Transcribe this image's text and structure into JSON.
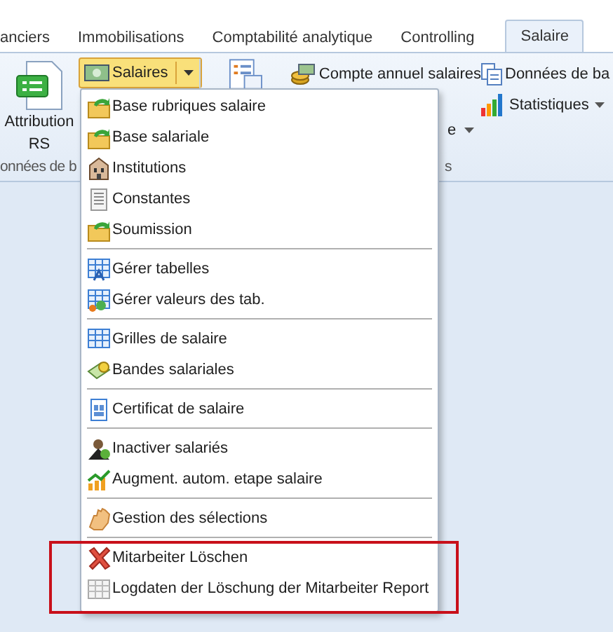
{
  "tabs": [
    {
      "label": "anciers",
      "selected": false
    },
    {
      "label": "Immobilisations",
      "selected": false
    },
    {
      "label": "Comptabilité analytique",
      "selected": false
    },
    {
      "label": "Controlling",
      "selected": false
    },
    {
      "label": "Salaire",
      "selected": true
    }
  ],
  "ribbon": {
    "attribution": {
      "lines": [
        "Attribution",
        "RS"
      ]
    },
    "salaires_button": {
      "label": "Salaires",
      "pressed": true
    },
    "compte_annuel": "Compte annuel salaires",
    "partial_dropdown": "e",
    "donnees": "Données de ba",
    "statistiques": "Statistiques",
    "group_labels": [
      "onnées de b",
      "s"
    ]
  },
  "menu": {
    "groups": [
      [
        {
          "label": "Base rubriques salaire"
        },
        {
          "label": "Base salariale"
        },
        {
          "label": "Institutions"
        },
        {
          "label": "Constantes"
        },
        {
          "label": "Soumission"
        }
      ],
      [
        {
          "label": "Gérer tabelles"
        },
        {
          "label": "Gérer valeurs des tab."
        }
      ],
      [
        {
          "label": "Grilles de salaire"
        },
        {
          "label": "Bandes salariales"
        }
      ],
      [
        {
          "label": "Certificat de salaire"
        }
      ],
      [
        {
          "label": "Inactiver salariés"
        },
        {
          "label": "Augment. autom. etape salaire"
        }
      ],
      [
        {
          "label": "Gestion des sélections"
        }
      ],
      [
        {
          "label": "Mitarbeiter Löschen"
        },
        {
          "label": "Logdaten der Löschung der Mitarbeiter Report"
        }
      ]
    ]
  }
}
